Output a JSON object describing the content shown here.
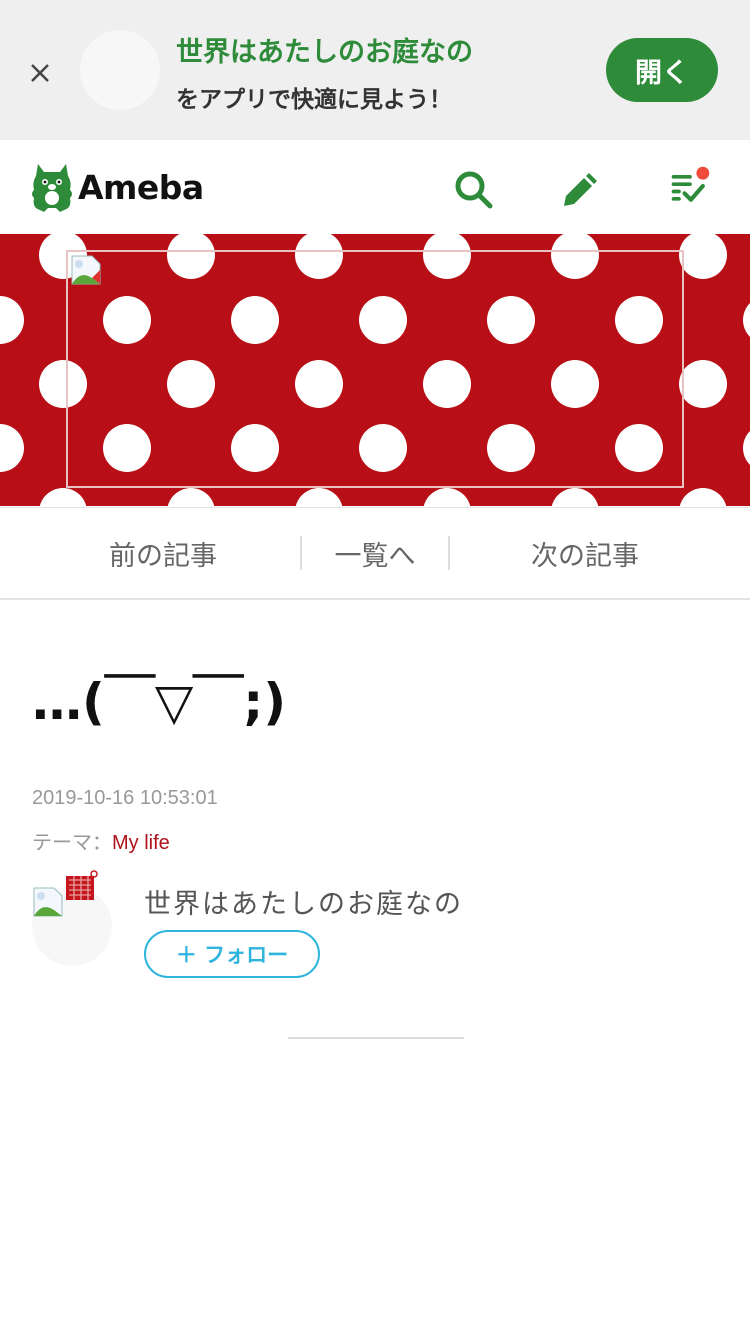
{
  "app_banner": {
    "title": "世界はあたしのお庭なの",
    "subtitle": "をアプリで快適に見よう！",
    "open_label": "開く"
  },
  "header": {
    "logo_text": "Ameba",
    "icons": [
      "search-icon",
      "pencil-icon",
      "checklist-icon"
    ],
    "notification_color": "#f04b3a",
    "accent_color": "#2e8b3a"
  },
  "blog_header": {
    "background_color": "#b80f16",
    "pattern": "white polka dots"
  },
  "nav": {
    "prev": "前の記事",
    "list": "一覧へ",
    "next": "次の記事"
  },
  "entry": {
    "title": "…(￣▽￣;)",
    "date": "2019-10-16 10:53:01",
    "theme_label": "テーマ：",
    "theme": "My life"
  },
  "author": {
    "name": "世界はあたしのお庭なの",
    "follow_label": "＋ フォロー"
  }
}
